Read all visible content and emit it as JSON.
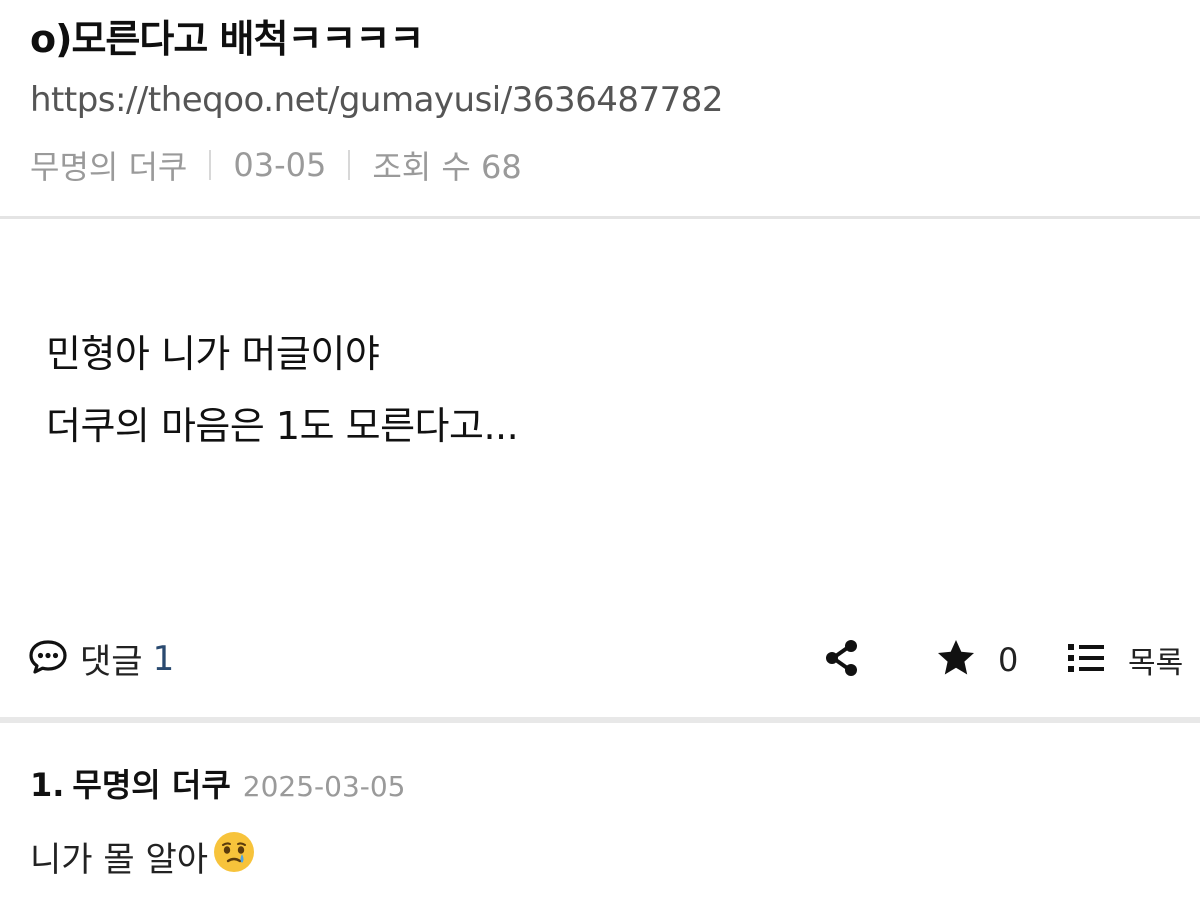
{
  "post": {
    "title": "o)모른다고 배척ㅋㅋㅋㅋ",
    "url": "https://theqoo.net/gumayusi/3636487782",
    "author": "무명의 더쿠",
    "date": "03-05",
    "views": "조회 수 68",
    "body_lines": [
      "민형아 니가 머글이야",
      "더쿠의 마음은 1도 모른다고..."
    ]
  },
  "actions": {
    "comment_label": "댓글",
    "comment_count": "1",
    "star_count": "0",
    "list_label": "목록",
    "icons": {
      "comment": "speech-bubble-icon",
      "share": "share-icon",
      "star": "star-icon",
      "list": "list-icon"
    }
  },
  "comments": [
    {
      "number": "1.",
      "author": "무명의 더쿠",
      "date": "2025-03-05",
      "text": "니가 몰 알아",
      "emoji": "face-holding-back-tears"
    }
  ],
  "colors": {
    "comment_count": "#2a4a70",
    "meta": "#9a9a9a",
    "emoji_face": "#f7c33b",
    "emoji_tear": "#4aa3e8"
  }
}
